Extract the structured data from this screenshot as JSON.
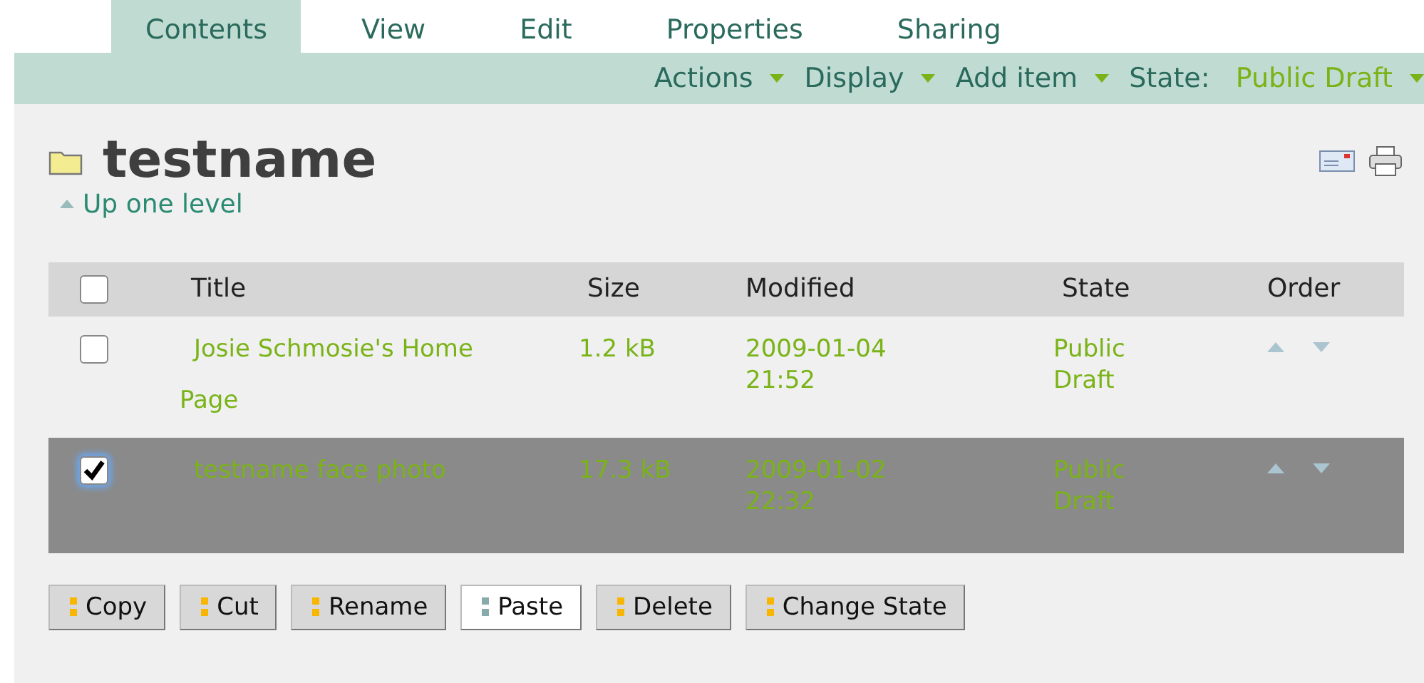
{
  "tabs": [
    {
      "label": "Contents",
      "selected": true
    },
    {
      "label": "View",
      "selected": false
    },
    {
      "label": "Edit",
      "selected": false
    },
    {
      "label": "Properties",
      "selected": false
    },
    {
      "label": "Sharing",
      "selected": false
    }
  ],
  "action_menus": [
    {
      "label": "Actions"
    },
    {
      "label": "Display"
    },
    {
      "label": "Add item"
    },
    {
      "label": "State:",
      "value": "Public Draft"
    }
  ],
  "heading": {
    "title": "testname",
    "up_link": "Up one level"
  },
  "table": {
    "all_checked": false,
    "columns": [
      "Title",
      "Size",
      "Modified",
      "State",
      "Order"
    ],
    "rows": [
      {
        "checked": false,
        "selected": false,
        "title": "Josie Schmosie's Home Page",
        "size": "1.2 kB",
        "modified": "2009-01-04 21:52",
        "state": "Public Draft"
      },
      {
        "checked": true,
        "selected": true,
        "title": "testname face photo",
        "size": "17.3 kB",
        "modified": "2009-01-02 22:32",
        "state": "Public Draft"
      }
    ]
  },
  "buttons": [
    {
      "label": "Copy",
      "disabled": false
    },
    {
      "label": "Cut",
      "disabled": false
    },
    {
      "label": "Rename",
      "disabled": false
    },
    {
      "label": "Paste",
      "disabled": true
    },
    {
      "label": "Delete",
      "disabled": false
    },
    {
      "label": "Change State",
      "disabled": false
    }
  ]
}
